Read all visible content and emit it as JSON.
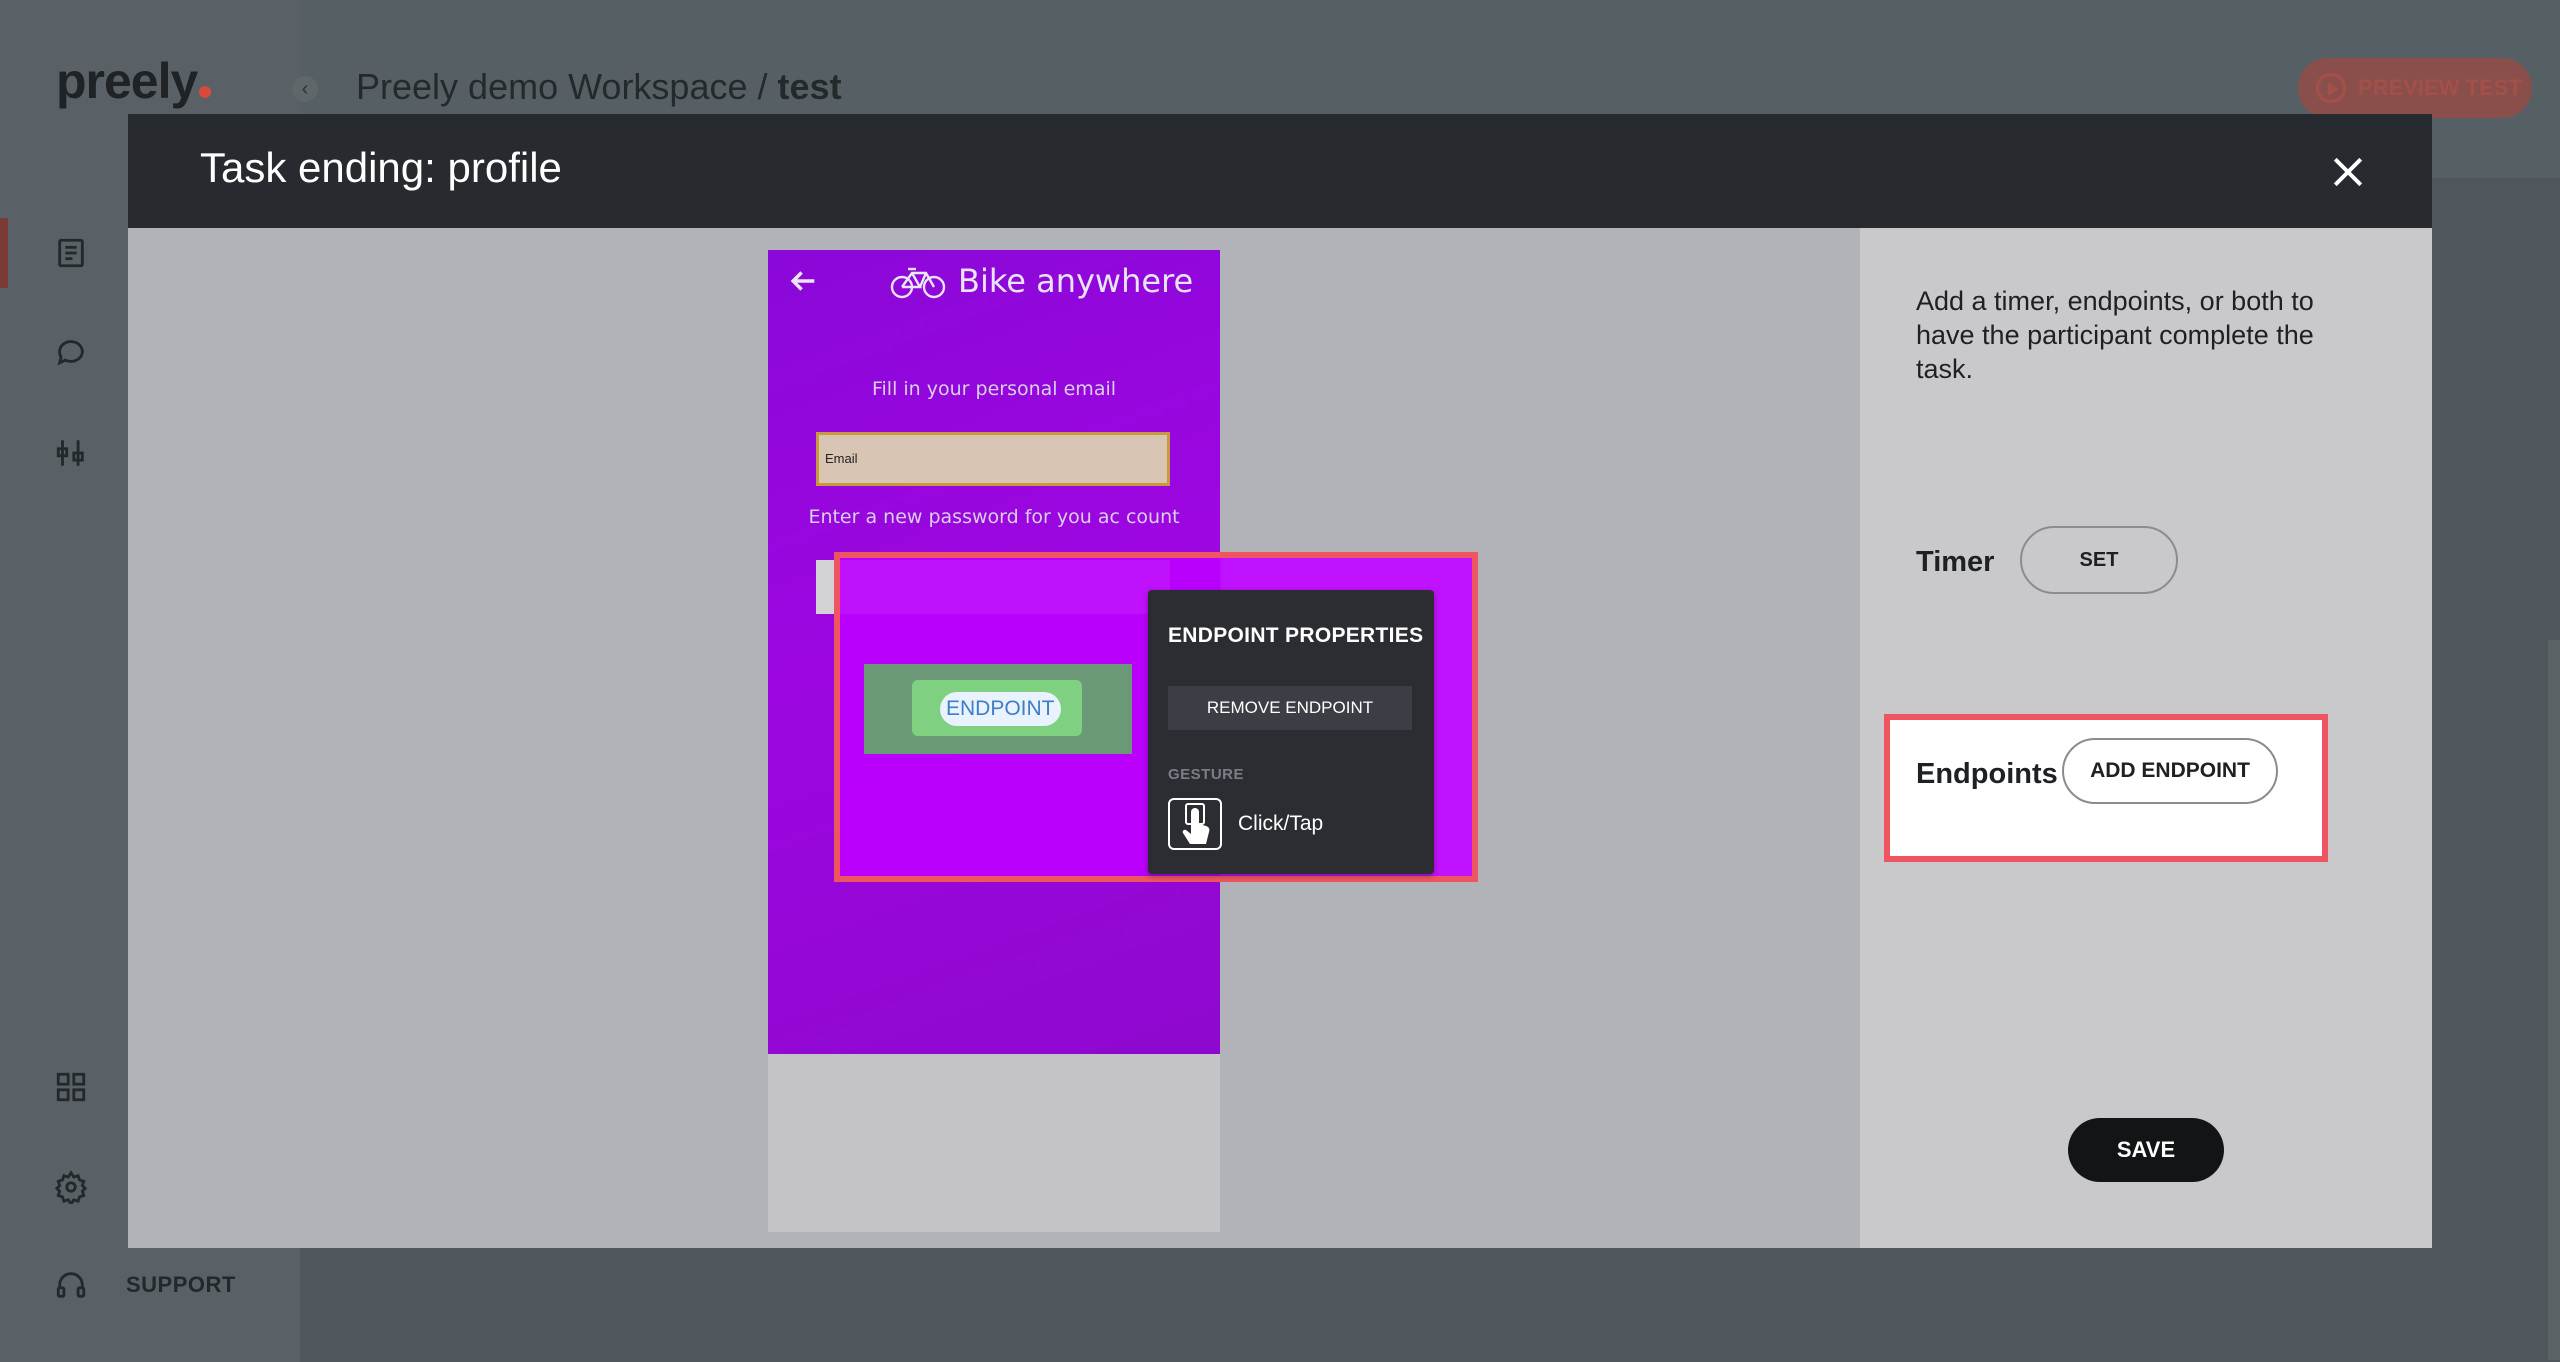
{
  "app": {
    "logo": "preely",
    "breadcrumb": {
      "workspace": "Preely demo Workspace /",
      "test": "test"
    },
    "preview_button": "PREVIEW TEST",
    "support_label": "SUPPORT"
  },
  "modal": {
    "title": "Task ending: profile",
    "phone": {
      "app_title": "Bike anywhere",
      "email_prompt": "Fill in your personal email",
      "email_placeholder": "Email",
      "password_prompt": "Enter a new password for you ac count"
    },
    "endpoint": {
      "chip_label": "ENDPOINT",
      "popup_title": "ENDPOINT PROPERTIES",
      "remove_button": "REMOVE ENDPOINT",
      "gesture_heading": "GESTURE",
      "gesture_value": "Click/Tap"
    },
    "panel": {
      "description": "Add a timer, endpoints, or both to have the participant complete the task.",
      "timer_label": "Timer",
      "set_button": "SET",
      "endpoints_label": "Endpoints",
      "add_endpoint_button": "ADD ENDPOINT",
      "save_button": "SAVE"
    }
  },
  "colors": {
    "highlight": "#ee5560",
    "modal_header": "#272a2f",
    "phone_background": "#9d06e0",
    "save_button": "#121416"
  },
  "icons": [
    "back-arrow-icon",
    "bicycle-icon",
    "close-icon",
    "tap-gesture-icon",
    "play-icon",
    "document-icon",
    "chat-icon",
    "sliders-icon",
    "grid-icon",
    "gear-icon",
    "headset-icon"
  ]
}
